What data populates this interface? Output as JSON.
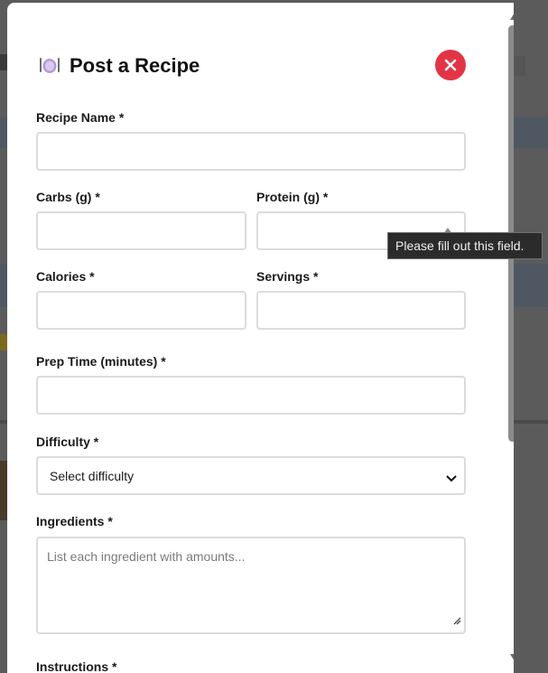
{
  "modal": {
    "title": "Post a Recipe",
    "title_icon": "plate-cutlery-icon",
    "close_icon": "close-icon"
  },
  "form": {
    "recipe_name": {
      "label": "Recipe Name *",
      "value": ""
    },
    "carbs": {
      "label": "Carbs (g) *",
      "value": ""
    },
    "protein": {
      "label": "Protein (g) *",
      "value": ""
    },
    "calories": {
      "label": "Calories *",
      "value": ""
    },
    "servings": {
      "label": "Servings *",
      "value": ""
    },
    "prep_time": {
      "label": "Prep Time (minutes) *",
      "value": ""
    },
    "difficulty": {
      "label": "Difficulty *",
      "selected": "Select difficulty"
    },
    "ingredients": {
      "label": "Ingredients *",
      "placeholder": "List each ingredient with amounts..."
    },
    "instructions": {
      "label": "Instructions *"
    }
  },
  "tooltip": {
    "text": "Please fill out this field."
  },
  "colors": {
    "close_button": "#e33446",
    "input_border": "#dcdcdc",
    "tooltip_bg": "#2b2b2b",
    "overlay": "#5b5b5b"
  }
}
